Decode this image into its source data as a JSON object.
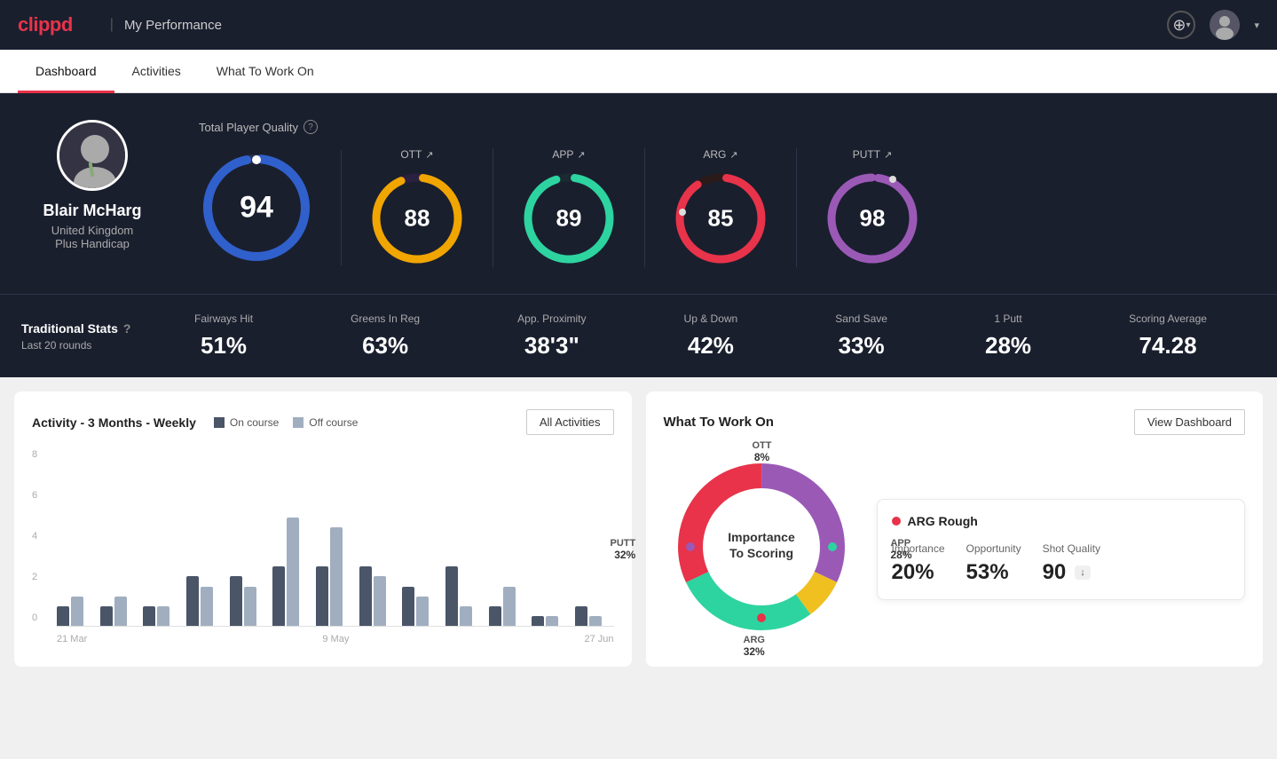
{
  "app": {
    "logo": "clippd",
    "nav_title": "My Performance"
  },
  "tabs": [
    {
      "id": "dashboard",
      "label": "Dashboard",
      "active": true
    },
    {
      "id": "activities",
      "label": "Activities",
      "active": false
    },
    {
      "id": "what-to-work-on",
      "label": "What To Work On",
      "active": false
    }
  ],
  "player": {
    "name": "Blair McHarg",
    "country": "United Kingdom",
    "handicap": "Plus Handicap"
  },
  "tpq": {
    "label": "Total Player Quality",
    "score": "94"
  },
  "metrics": [
    {
      "id": "ott",
      "label": "OTT",
      "value": "88",
      "color_fg": "#f0a500",
      "color_bg": "#2a2040",
      "trend": "↗"
    },
    {
      "id": "app",
      "label": "APP",
      "value": "89",
      "color_fg": "#2dd4a0",
      "color_bg": "#1a2a30",
      "trend": "↗"
    },
    {
      "id": "arg",
      "label": "ARG",
      "value": "85",
      "color_fg": "#e8334a",
      "color_bg": "#2a1a1a",
      "trend": "↗"
    },
    {
      "id": "putt",
      "label": "PUTT",
      "value": "98",
      "color_fg": "#9b59b6",
      "color_bg": "#1e1a2a",
      "trend": "↗"
    }
  ],
  "traditional_stats": {
    "title": "Traditional Stats",
    "subtitle": "Last 20 rounds",
    "items": [
      {
        "id": "fairways-hit",
        "label": "Fairways Hit",
        "value": "51%"
      },
      {
        "id": "greens-in-reg",
        "label": "Greens In Reg",
        "value": "63%"
      },
      {
        "id": "app-proximity",
        "label": "App. Proximity",
        "value": "38'3\""
      },
      {
        "id": "up-and-down",
        "label": "Up & Down",
        "value": "42%"
      },
      {
        "id": "sand-save",
        "label": "Sand Save",
        "value": "33%"
      },
      {
        "id": "one-putt",
        "label": "1 Putt",
        "value": "28%"
      },
      {
        "id": "scoring-average",
        "label": "Scoring Average",
        "value": "74.28"
      }
    ]
  },
  "activity_chart": {
    "title": "Activity - 3 Months - Weekly",
    "legend_on_course": "On course",
    "legend_off_course": "Off course",
    "all_activities_btn": "All Activities",
    "x_labels": [
      "21 Mar",
      "9 May",
      "27 Jun"
    ],
    "bars": [
      {
        "on": 1,
        "off": 1.5
      },
      {
        "on": 1,
        "off": 1.5
      },
      {
        "on": 1,
        "off": 1
      },
      {
        "on": 2.5,
        "off": 2
      },
      {
        "on": 2.5,
        "off": 2
      },
      {
        "on": 3,
        "off": 5.5
      },
      {
        "on": 3,
        "off": 5
      },
      {
        "on": 3,
        "off": 2.5
      },
      {
        "on": 2,
        "off": 1.5
      },
      {
        "on": 3,
        "off": 1
      },
      {
        "on": 1,
        "off": 2
      },
      {
        "on": 0.5,
        "off": 0.5
      },
      {
        "on": 1,
        "off": 0.5
      }
    ],
    "y_labels": [
      "8",
      "6",
      "4",
      "2",
      "0"
    ]
  },
  "what_to_work_on": {
    "title": "What To Work On",
    "view_dashboard_btn": "View Dashboard",
    "center_text": "Importance\nTo Scoring",
    "segments": [
      {
        "id": "ott",
        "label": "OTT",
        "pct": "8%",
        "color": "#f0c020"
      },
      {
        "id": "app",
        "label": "APP",
        "pct": "28%",
        "color": "#2dd4a0"
      },
      {
        "id": "arg",
        "label": "ARG",
        "pct": "32%",
        "color": "#e8334a"
      },
      {
        "id": "putt",
        "label": "PUTT",
        "pct": "32%",
        "color": "#9b59b6"
      }
    ],
    "card": {
      "title": "ARG Rough",
      "dot_color": "#e8334a",
      "metrics": [
        {
          "label": "Importance",
          "value": "20%"
        },
        {
          "label": "Opportunity",
          "value": "53%"
        },
        {
          "label": "Shot Quality",
          "value": "90",
          "badge": "↓"
        }
      ]
    }
  }
}
